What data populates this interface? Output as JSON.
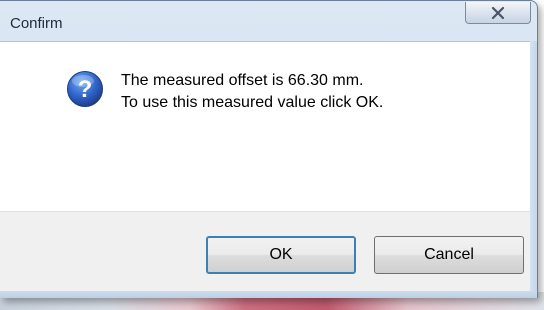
{
  "dialog": {
    "title": "Confirm",
    "close_glyph": "X",
    "icon": "question-icon",
    "message_line1": "The measured offset is 66.30 mm.",
    "message_line2": "To use this measured value click OK.",
    "ok_label": "OK",
    "cancel_label": "Cancel"
  },
  "colors": {
    "accent": "#3c7fb1",
    "question_icon": "#2a5fbf"
  }
}
